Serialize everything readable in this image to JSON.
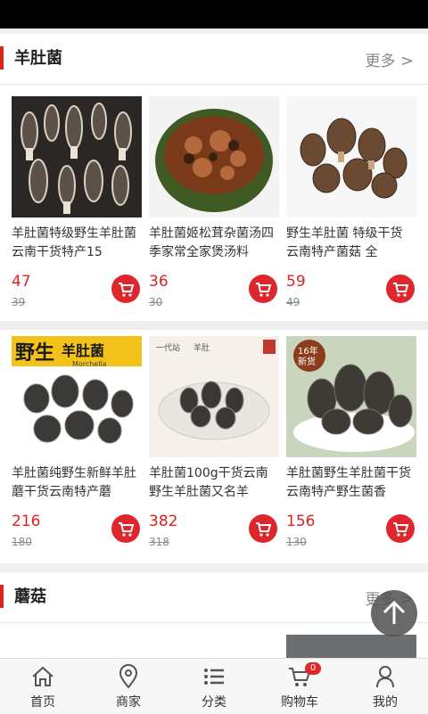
{
  "sections": [
    {
      "title": "羊肚菌",
      "more": "更多",
      "products": [
        {
          "name": "羊肚菌特级野生羊肚菌云南干货特产15",
          "price": "47",
          "old_price": "39"
        },
        {
          "name": "羊肚菌姬松茸杂菌汤四季家常全家煲汤料",
          "price": "36",
          "old_price": "30"
        },
        {
          "name": "野生羊肚菌 特级干货 云南特产菌菇 全",
          "price": "59",
          "old_price": "49"
        },
        {
          "name": "羊肚菌纯野生新鲜羊肚蘑干货云南特产蘑",
          "price": "216",
          "old_price": "180",
          "image_text": {
            "line1": "野生",
            "line2": "羊肚菌",
            "line3": "Morchella"
          }
        },
        {
          "name": "羊肚菌100g干货云南野生羊肚菌又名羊",
          "price": "382",
          "old_price": "318",
          "image_text": {
            "line1": "一代站",
            "line2": "羊肚"
          }
        },
        {
          "name": "羊肚菌野生羊肚菌干货云南特产野生菌香",
          "price": "156",
          "old_price": "130",
          "image_text": {
            "line1": "16年",
            "line2": "新货"
          }
        }
      ]
    },
    {
      "title": "蘑菇",
      "more": "更多"
    }
  ],
  "nav": [
    {
      "label": "首页",
      "icon": "home-icon"
    },
    {
      "label": "商家",
      "icon": "location-pin-icon"
    },
    {
      "label": "分类",
      "icon": "list-icon"
    },
    {
      "label": "购物车",
      "icon": "cart-icon",
      "badge": "0"
    },
    {
      "label": "我的",
      "icon": "user-icon"
    }
  ],
  "colors": {
    "accent": "#e0262d",
    "title_bar": "#d9251c",
    "price": "#d9251c"
  }
}
